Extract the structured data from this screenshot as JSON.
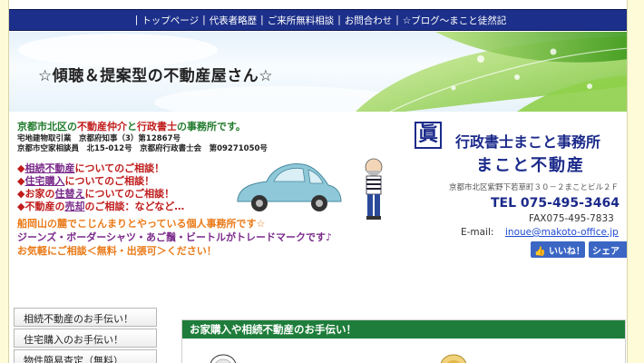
{
  "nav": {
    "items": [
      "トップページ",
      "代表者略歴",
      "ご来所無料相談",
      "お問合わせ",
      "☆ブログ〜まこと徒然記"
    ],
    "separator": "|"
  },
  "hero": {
    "title": "☆傾聴＆提案型の不動産屋さん☆"
  },
  "intro": {
    "line1_part1": "京都市北区の",
    "line1_part2": "不動産仲介",
    "line1_part3": "と",
    "line1_part4": "行政書士",
    "line1_part5": "の事務所です。",
    "license1": "宅地建物取引業　京都府知事（3）第12867号",
    "license2": "京都市空家相談員　北15-012号　京都府行政書士会　第09271050号"
  },
  "consult": {
    "items": [
      {
        "bullet": "◆",
        "highlight": "相続不動産",
        "rest": "についてのご相談！"
      },
      {
        "bullet": "◆",
        "highlight": "住宅購入",
        "rest": "についてのご相談！"
      },
      {
        "bullet": "◆",
        "prefix": "お家の",
        "highlight": "住替え",
        "rest": "についてのご相談！"
      },
      {
        "bullet": "◆",
        "prefix": "不動産の",
        "highlight": "売却",
        "rest": "のご相談：などなど…"
      }
    ]
  },
  "pitch": {
    "line1": "船岡山の麓でこじんまりとやっている個人事務所です☆",
    "line2": "ジーンズ・ボーダーシャツ・あご鬚・ビートルがトレードマークです♪",
    "line3": "お気軽にご相談＜無料・出張可＞ください！"
  },
  "office": {
    "logo_glyph": "眞",
    "name1": "行政書士まこと事務所",
    "name2": "まこと不動産",
    "address": "京都市北区紫野下若草町３０－２まことビル２Ｆ",
    "tel": "TEL 075-495-3464",
    "fax": "FAX075-495-7833",
    "email_label": "E-mail:",
    "email": "inoue@makoto-office.jp"
  },
  "facebook": {
    "like": "いいね！",
    "share": "シェア",
    "like_icon": "thumbs-up-icon"
  },
  "sidemenu": {
    "items": [
      "相続不動産のお手伝い！",
      "住宅購入のお手伝い！",
      "物件簡易査定（無料）"
    ]
  },
  "bottom_section": {
    "title": "お家購入や相続不動産のお手伝い！"
  },
  "colors": {
    "background": "#fdfbd8",
    "nav": "#1c2f8a",
    "intro_green": "#1f7a2b",
    "consult_red": "#c01c1c",
    "highlight_purple": "#7a2a8a",
    "pitch_orange": "#ea7a18",
    "office_navy": "#1b2a8a",
    "section_green": "#1e7d3a",
    "facebook_blue": "#3b66c4",
    "car_body": "#8fc8d8"
  }
}
